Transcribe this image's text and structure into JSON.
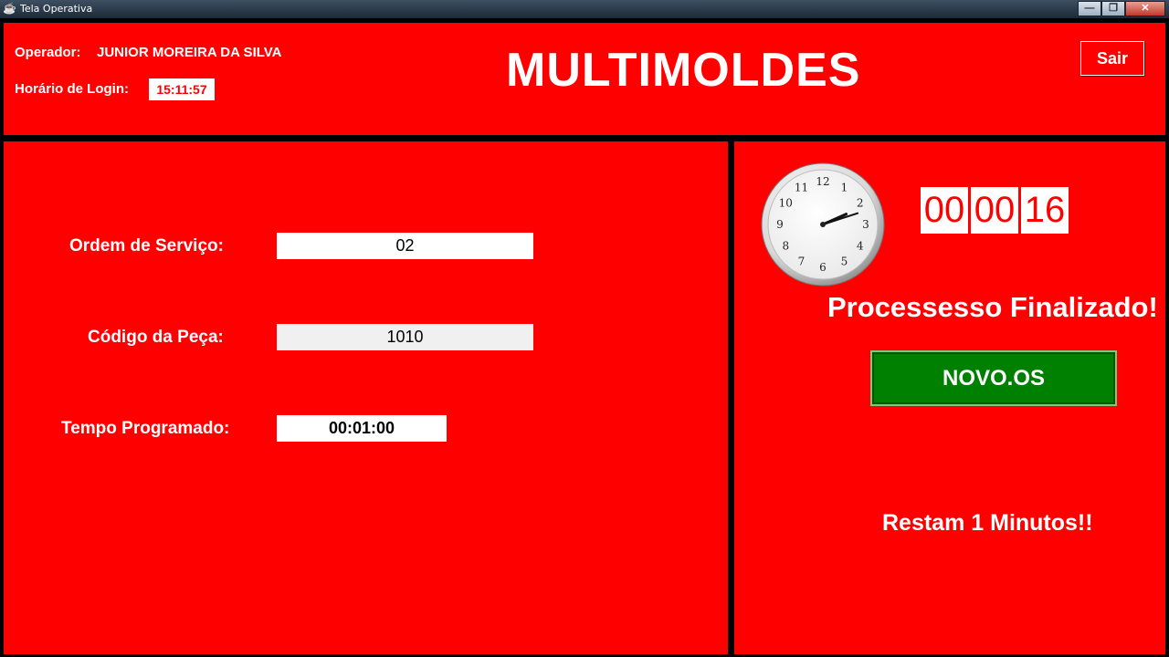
{
  "window": {
    "title": "Tela Operativa",
    "minimize_glyph": "—",
    "maximize_glyph": "❐",
    "close_glyph": "✕"
  },
  "header": {
    "operator_label": "Operador:",
    "operator_name": "JUNIOR MOREIRA DA SILVA",
    "login_label": "Horário de Login:",
    "login_time": "15:11:57",
    "brand": "MULTIMOLDES",
    "exit_button": "Sair"
  },
  "form": {
    "service_order_label": "Ordem de Serviço:",
    "service_order_value": "02",
    "part_code_label": "Código da Peça:",
    "part_code_value": "1010",
    "programmed_time_label": "Tempo Programado:",
    "programmed_time_value": "00:01:00"
  },
  "timer": {
    "hours": "00",
    "minutes": "00",
    "seconds": "16",
    "clock_numbers": [
      "12",
      "1",
      "2",
      "3",
      "4",
      "5",
      "6",
      "7",
      "8",
      "9",
      "10",
      "11"
    ],
    "clock_hour": 2,
    "clock_minute": 12
  },
  "status": {
    "message": "Processesso Finalizado!",
    "new_os_button": "NOVO.OS",
    "remaining": "Restam 1 Minutos!!"
  },
  "colors": {
    "background": "#ff0000",
    "button_green": "#008000",
    "text": "#ffffff"
  }
}
